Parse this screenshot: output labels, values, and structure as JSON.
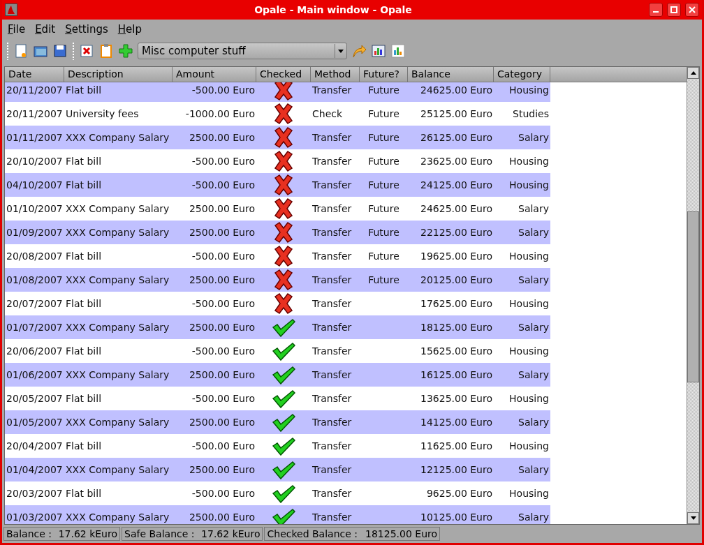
{
  "window": {
    "title": "Opale - Main window - Opale"
  },
  "menu": [
    "File",
    "Edit",
    "Settings",
    "Help"
  ],
  "toolbar": {
    "account": "Misc computer stuff"
  },
  "table": {
    "columns": [
      "Date",
      "Description",
      "Amount",
      "Checked",
      "Method",
      "Future?",
      "Balance",
      "Category"
    ],
    "rows": [
      {
        "date": "20/11/2007",
        "description": "Flat bill",
        "amount": "-500.00 Euro",
        "checked": false,
        "method": "Transfer",
        "future": "Future",
        "balance": "24625.00 Euro",
        "category": "Housing"
      },
      {
        "date": "20/11/2007",
        "description": "University fees",
        "amount": "-1000.00 Euro",
        "checked": false,
        "method": "Check",
        "future": "Future",
        "balance": "25125.00 Euro",
        "category": "Studies"
      },
      {
        "date": "01/11/2007",
        "description": "XXX Company Salary",
        "amount": "2500.00 Euro",
        "checked": false,
        "method": "Transfer",
        "future": "Future",
        "balance": "26125.00 Euro",
        "category": "Salary"
      },
      {
        "date": "20/10/2007",
        "description": "Flat bill",
        "amount": "-500.00 Euro",
        "checked": false,
        "method": "Transfer",
        "future": "Future",
        "balance": "23625.00 Euro",
        "category": "Housing"
      },
      {
        "date": "04/10/2007",
        "description": "Flat bill",
        "amount": "-500.00 Euro",
        "checked": false,
        "method": "Transfer",
        "future": "Future",
        "balance": "24125.00 Euro",
        "category": "Housing"
      },
      {
        "date": "01/10/2007",
        "description": "XXX Company Salary",
        "amount": "2500.00 Euro",
        "checked": false,
        "method": "Transfer",
        "future": "Future",
        "balance": "24625.00 Euro",
        "category": "Salary"
      },
      {
        "date": "01/09/2007",
        "description": "XXX Company Salary",
        "amount": "2500.00 Euro",
        "checked": false,
        "method": "Transfer",
        "future": "Future",
        "balance": "22125.00 Euro",
        "category": "Salary"
      },
      {
        "date": "20/08/2007",
        "description": "Flat bill",
        "amount": "-500.00 Euro",
        "checked": false,
        "method": "Transfer",
        "future": "Future",
        "balance": "19625.00 Euro",
        "category": "Housing"
      },
      {
        "date": "01/08/2007",
        "description": "XXX Company Salary",
        "amount": "2500.00 Euro",
        "checked": false,
        "method": "Transfer",
        "future": "Future",
        "balance": "20125.00 Euro",
        "category": "Salary"
      },
      {
        "date": "20/07/2007",
        "description": "Flat bill",
        "amount": "-500.00 Euro",
        "checked": false,
        "method": "Transfer",
        "balance": "17625.00 Euro",
        "category": "Housing"
      },
      {
        "date": "01/07/2007",
        "description": "XXX Company Salary",
        "amount": "2500.00 Euro",
        "checked": true,
        "method": "Transfer",
        "balance": "18125.00 Euro",
        "category": "Salary"
      },
      {
        "date": "20/06/2007",
        "description": "Flat bill",
        "amount": "-500.00 Euro",
        "checked": true,
        "method": "Transfer",
        "balance": "15625.00 Euro",
        "category": "Housing"
      },
      {
        "date": "01/06/2007",
        "description": "XXX Company Salary",
        "amount": "2500.00 Euro",
        "checked": true,
        "method": "Transfer",
        "balance": "16125.00 Euro",
        "category": "Salary"
      },
      {
        "date": "20/05/2007",
        "description": "Flat bill",
        "amount": "-500.00 Euro",
        "checked": true,
        "method": "Transfer",
        "balance": "13625.00 Euro",
        "category": "Housing"
      },
      {
        "date": "01/05/2007",
        "description": "XXX Company Salary",
        "amount": "2500.00 Euro",
        "checked": true,
        "method": "Transfer",
        "balance": "14125.00 Euro",
        "category": "Salary"
      },
      {
        "date": "20/04/2007",
        "description": "Flat bill",
        "amount": "-500.00 Euro",
        "checked": true,
        "method": "Transfer",
        "balance": "11625.00 Euro",
        "category": "Housing"
      },
      {
        "date": "01/04/2007",
        "description": "XXX Company Salary",
        "amount": "2500.00 Euro",
        "checked": true,
        "method": "Transfer",
        "balance": "12125.00 Euro",
        "category": "Salary"
      },
      {
        "date": "20/03/2007",
        "description": "Flat bill",
        "amount": "-500.00 Euro",
        "checked": true,
        "method": "Transfer",
        "balance": "9625.00 Euro",
        "category": "Housing"
      },
      {
        "date": "01/03/2007",
        "description": "XXX Company Salary",
        "amount": "2500.00 Euro",
        "checked": true,
        "method": "Transfer",
        "balance": "10125.00 Euro",
        "category": "Salary"
      }
    ]
  },
  "status_bar": [
    {
      "label": "Balance :",
      "value": "17.62 kEuro"
    },
    {
      "label": "Safe Balance :",
      "value": "17.62 kEuro"
    },
    {
      "label": "Checked Balance :",
      "value": "18125.00 Euro"
    }
  ]
}
